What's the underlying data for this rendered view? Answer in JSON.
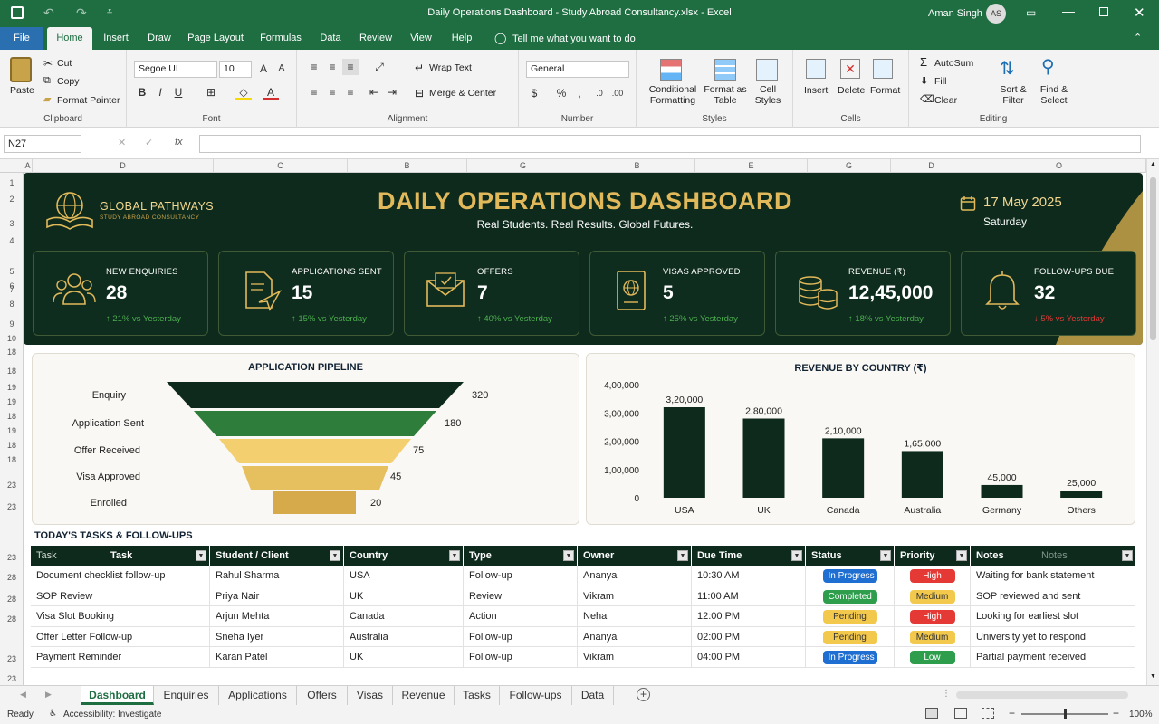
{
  "window": {
    "title": "Daily Operations Dashboard - Study Abroad Consultancy.xlsx - Excel",
    "user_name": "Aman Singh",
    "user_initials": "AS"
  },
  "ribbon_tabs": [
    "File",
    "Home",
    "Insert",
    "Draw",
    "Page Layout",
    "Formulas",
    "Data",
    "Review",
    "View",
    "Help"
  ],
  "tell_me": "Tell me what you want to do",
  "ribbon": {
    "clipboard": {
      "paste": "Paste",
      "cut": "Cut",
      "copy": "Copy",
      "format_painter": "Format Painter",
      "label": "Clipboard"
    },
    "font": {
      "name": "Segoe UI",
      "size": "10",
      "label": "Font"
    },
    "alignment": {
      "wrap": "Wrap Text",
      "merge": "Merge & Center",
      "label": "Alignment"
    },
    "number": {
      "format": "General",
      "label": "Number"
    },
    "styles": {
      "cond1": "Conditional",
      "cond2": "Formatting",
      "fmt1": "Format as",
      "fmt2": "Table",
      "cell1": "Cell",
      "cell2": "Styles",
      "label": "Styles"
    },
    "cells": {
      "insert": "Insert",
      "delete": "Delete",
      "format": "Format",
      "label": "Cells"
    },
    "editing": {
      "autosum": "AutoSum",
      "fill": "Fill",
      "clear": "Clear",
      "sort1": "Sort &",
      "sort2": "Filter",
      "find1": "Find &",
      "find2": "Select",
      "label": "Editing"
    }
  },
  "formula_bar": {
    "name_box": "N27",
    "fx": "fx",
    "formula": ""
  },
  "columns": [
    "A",
    "D",
    "C",
    "B",
    "G",
    "B",
    "E",
    "G",
    "D",
    "O"
  ],
  "rows": [
    "1",
    "2",
    "3",
    "4",
    "5",
    "6",
    "7",
    "8",
    "9",
    "10",
    "18",
    "18",
    "19",
    "19",
    "18",
    "19",
    "18",
    "18",
    "23",
    "23",
    "23",
    "28",
    "28",
    "28",
    "23",
    "23"
  ],
  "brand": {
    "name": "GLOBAL PATHWAYS",
    "tagline": "STUDY ABROAD CONSULTANCY"
  },
  "dashboard": {
    "title": "DAILY OPERATIONS DASHBOARD",
    "subtitle": "Real Students. Real Results. Global Futures.",
    "date": "17 May 2025",
    "day": "Saturday"
  },
  "kpis": [
    {
      "label": "NEW ENQUIRIES",
      "value": "28",
      "change": "↑ 21% vs Yesterday",
      "trend": "up",
      "icon": "people-icon"
    },
    {
      "label": "APPLICATIONS SENT",
      "value": "15",
      "change": "↑ 15% vs Yesterday",
      "trend": "up",
      "icon": "document-send-icon"
    },
    {
      "label": "OFFERS",
      "value": "7",
      "change": "↑ 40% vs Yesterday",
      "trend": "up",
      "icon": "mail-icon"
    },
    {
      "label": "VISAS APPROVED",
      "value": "5",
      "change": "↑ 25% vs Yesterday",
      "trend": "up",
      "icon": "passport-icon"
    },
    {
      "label": "REVENUE (₹)",
      "value": "12,45,000",
      "change": "↑ 18% vs Yesterday",
      "trend": "up",
      "icon": "coins-icon"
    },
    {
      "label": "FOLLOW-UPS DUE",
      "value": "32",
      "change": "↓ 5% vs Yesterday",
      "trend": "down",
      "icon": "bell-icon"
    }
  ],
  "colors": {
    "dark_green": "#0d2a1c",
    "green": "#2e7d3a",
    "gold": "#e2b95a",
    "up": "#4caf50",
    "down": "#e53935"
  },
  "pipeline": {
    "title": "APPLICATION PIPELINE",
    "stages": [
      {
        "label": "Enquiry",
        "value": "320"
      },
      {
        "label": "Application Sent",
        "value": "180"
      },
      {
        "label": "Offer Received",
        "value": "75"
      },
      {
        "label": "Visa Approved",
        "value": "45"
      },
      {
        "label": "Enrolled",
        "value": "20"
      }
    ]
  },
  "chart_data": {
    "type": "bar",
    "title": "REVENUE BY COUNTRY (₹)",
    "categories": [
      "USA",
      "UK",
      "Canada",
      "Australia",
      "Germany",
      "Others"
    ],
    "values": [
      320000,
      280000,
      210000,
      165000,
      45000,
      25000
    ],
    "value_labels": [
      "3,20,000",
      "2,80,000",
      "2,10,000",
      "1,65,000",
      "45,000",
      "25,000"
    ],
    "y_ticks": [
      "0",
      "1,00,000",
      "2,00,000",
      "3,00,000",
      "4,00,000"
    ],
    "ylim": [
      0,
      400000
    ],
    "grid": false
  },
  "tasks": {
    "title": "TODAY'S TASKS & FOLLOW-UPS",
    "headers": [
      "Task",
      "Student / Client",
      "Country",
      "Type",
      "Owner",
      "Due Time",
      "Status",
      "Priority",
      "Notes"
    ],
    "header_ghosts": {
      "task": "Task",
      "notes": "Notes"
    },
    "rows": [
      [
        "Document checklist follow-up",
        "Rahul Sharma",
        "USA",
        "Follow-up",
        "Ananya",
        "10:30 AM",
        "In Progress",
        "High",
        "Waiting for bank statement"
      ],
      [
        "SOP Review",
        "Priya Nair",
        "UK",
        "Review",
        "Vikram",
        "11:00 AM",
        "Completed",
        "Medium",
        "SOP reviewed and sent"
      ],
      [
        "Visa Slot Booking",
        "Arjun Mehta",
        "Canada",
        "Action",
        "Neha",
        "12:00 PM",
        "Pending",
        "High",
        "Looking for earliest slot"
      ],
      [
        "Offer Letter Follow-up",
        "Sneha Iyer",
        "Australia",
        "Follow-up",
        "Ananya",
        "02:00 PM",
        "Pending",
        "Medium",
        "University yet to respond"
      ],
      [
        "Payment Reminder",
        "Karan Patel",
        "UK",
        "Follow-up",
        "Vikram",
        "04:00 PM",
        "In Progress",
        "Low",
        "Partial payment received"
      ]
    ]
  },
  "sheet_tabs": [
    "Dashboard",
    "Enquiries",
    "Applications",
    "Offers",
    "Visas",
    "Revenue",
    "Tasks",
    "Follow-ups",
    "Data"
  ],
  "status": {
    "ready": "Ready",
    "accessibility": "Accessibility: Investigate",
    "zoom": "100%"
  }
}
